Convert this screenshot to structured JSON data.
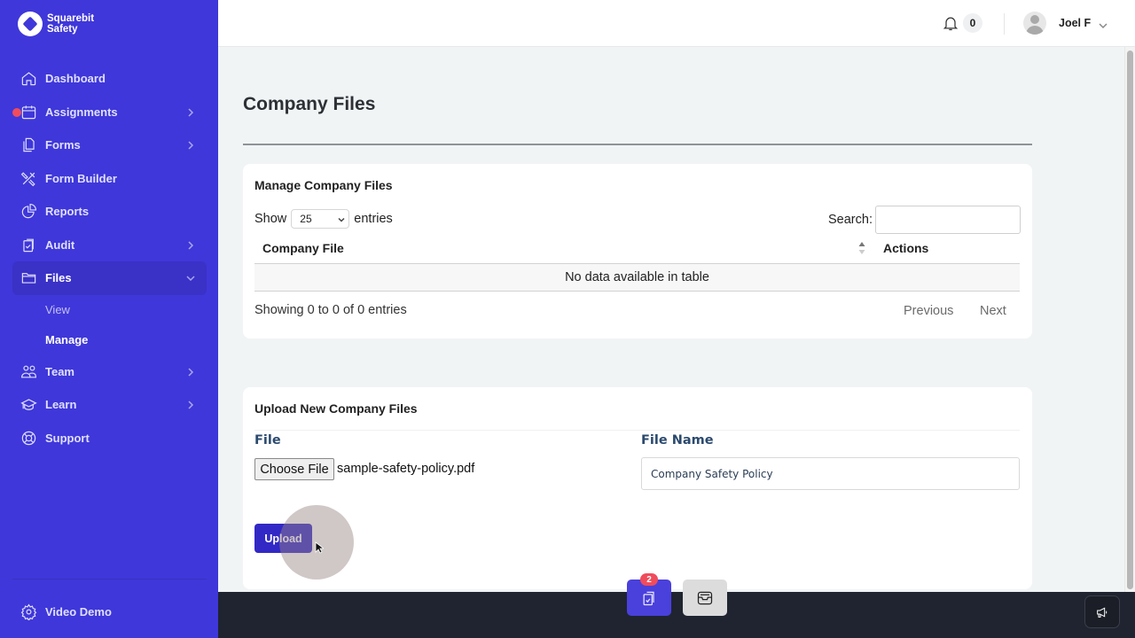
{
  "brand": {
    "line1": "Squarebit",
    "line2": "Safety"
  },
  "sidebar": {
    "items": [
      {
        "label": "Dashboard",
        "icon": "home-icon"
      },
      {
        "label": "Assignments",
        "icon": "calendar-icon",
        "has_children": true,
        "alert_dot": true
      },
      {
        "label": "Forms",
        "icon": "documents-icon",
        "has_children": true
      },
      {
        "label": "Form Builder",
        "icon": "tools-icon"
      },
      {
        "label": "Reports",
        "icon": "pie-chart-icon"
      },
      {
        "label": "Audit",
        "icon": "clipboard-check-icon",
        "has_children": true
      },
      {
        "label": "Files",
        "icon": "folder-icon",
        "has_children": true,
        "expanded": true,
        "active": true,
        "children": [
          {
            "label": "View"
          },
          {
            "label": "Manage",
            "active": true
          }
        ]
      },
      {
        "label": "Team",
        "icon": "users-icon",
        "has_children": true
      },
      {
        "label": "Learn",
        "icon": "graduation-cap-icon",
        "has_children": true
      },
      {
        "label": "Support",
        "icon": "lifebuoy-icon"
      }
    ],
    "bottom": {
      "label": "Video Demo",
      "icon": "gear-icon"
    }
  },
  "topbar": {
    "notifications_count": "0",
    "user_name": "Joel F"
  },
  "page": {
    "title": "Company Files"
  },
  "manage_card": {
    "title": "Manage Company Files",
    "show_label": "Show",
    "page_size": "25",
    "entries_label": "entries",
    "search_label": "Search:",
    "search_value": "",
    "columns": [
      "Company File",
      "Actions"
    ],
    "empty_message": "No data available in table",
    "info": "Showing 0 to 0 of 0 entries",
    "previous_label": "Previous",
    "next_label": "Next"
  },
  "upload_card": {
    "title": "Upload New Company Files",
    "file_label": "File",
    "choose_button": "Choose File",
    "chosen_file": "sample-safety-policy.pdf",
    "file_name_label": "File Name",
    "file_name_value": "Company Safety Policy",
    "upload_button": "Upload"
  },
  "dock": {
    "tasks_badge": "2"
  },
  "colors": {
    "sidebar": "#3f37d9",
    "primary_button": "#3228c6",
    "badge": "#ef4c5c",
    "bottom_bar": "#1f2430"
  }
}
